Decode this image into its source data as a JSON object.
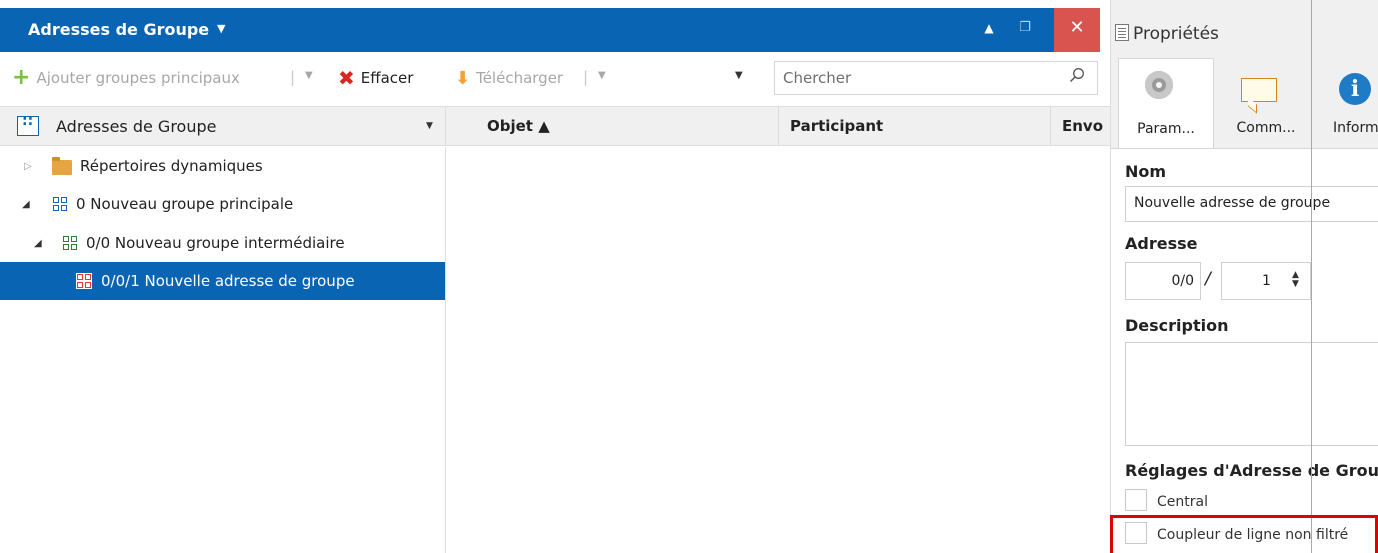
{
  "panel": {
    "title": "Adresses de Groupe",
    "caret": "▼",
    "window_buttons": {
      "up": "▲",
      "restore": "❐",
      "close": "✕"
    }
  },
  "toolbar": {
    "add_main_groups": "Ajouter groupes principaux",
    "delete": "Effacer",
    "download": "Télécharger",
    "separator": "|",
    "dropdown": "▼"
  },
  "search": {
    "placeholder": "Chercher"
  },
  "tree": {
    "header": "Adresses de Groupe",
    "header_arrow": "▼",
    "items": [
      {
        "label": "Répertoires dynamiques",
        "toggle": "▷",
        "icon": "folder-icon"
      },
      {
        "label": "0 Nouveau groupe principale",
        "toggle": "◢",
        "icon": "main-group-icon",
        "color": "#1565c0"
      },
      {
        "label": "0/0 Nouveau groupe intermédiaire",
        "toggle": "◢",
        "icon": "middle-group-icon",
        "color": "#2e7d32"
      },
      {
        "label": "0/0/1 Nouvelle adresse de groupe",
        "toggle": "",
        "icon": "group-address-icon",
        "color": "#d32f2f",
        "selected": true
      }
    ]
  },
  "grid": {
    "columns": [
      {
        "label": "Objet ▲"
      },
      {
        "label": "Participant"
      },
      {
        "label": "Envo"
      }
    ]
  },
  "properties": {
    "title": "Propriétés",
    "tabs": [
      {
        "label": "Param...",
        "icon": "gear-icon",
        "active": true
      },
      {
        "label": "Comm...",
        "icon": "comment-icon",
        "active": false
      },
      {
        "label": "Inform",
        "icon": "info-icon",
        "active": false
      }
    ],
    "name_label": "Nom",
    "name_value": "Nouvelle adresse de groupe",
    "address_label": "Adresse",
    "address_main": "0/0",
    "address_sep": "/",
    "address_sub": "1",
    "description_label": "Description",
    "description_value": "",
    "settings_label": "Réglages d'Adresse de Group",
    "central_label": "Central",
    "central_checked": false,
    "coupler_label": "Coupleur de ligne non filtré",
    "coupler_checked": false
  },
  "colors": {
    "accent": "#0a64b4",
    "close": "#d9534f",
    "highlight_box": "#e00000"
  }
}
